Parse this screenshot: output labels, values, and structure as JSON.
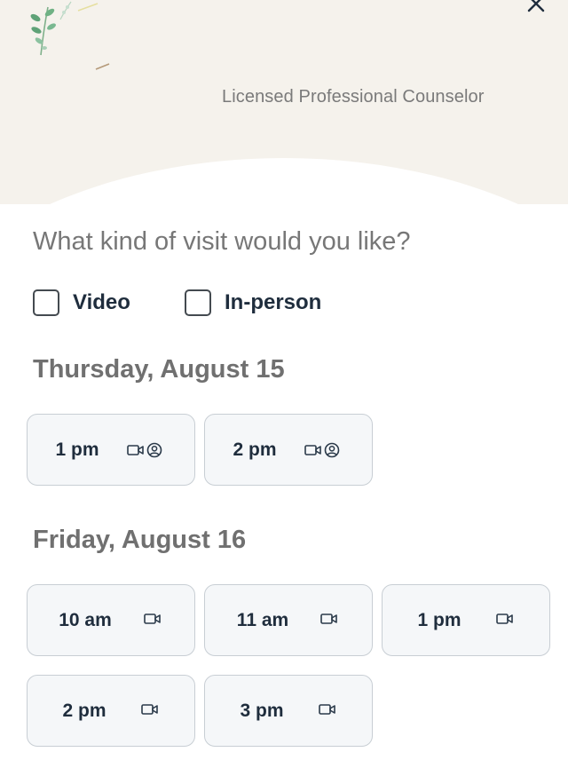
{
  "provider": {
    "credential": "Licensed Professional Counselor"
  },
  "visit_question": "What kind of visit would you like?",
  "visit_types": [
    {
      "label": "Video",
      "checked": false
    },
    {
      "label": "In-person",
      "checked": false
    }
  ],
  "days": [
    {
      "heading": "Thursday, August 15",
      "slots": [
        {
          "time": "1 pm",
          "icons": [
            "video-icon",
            "in-person-icon"
          ]
        },
        {
          "time": "2 pm",
          "icons": [
            "video-icon",
            "in-person-icon"
          ]
        }
      ]
    },
    {
      "heading": "Friday, August 16",
      "slots": [
        {
          "time": "10 am",
          "icons": [
            "video-icon"
          ]
        },
        {
          "time": "11 am",
          "icons": [
            "video-icon"
          ]
        },
        {
          "time": "1 pm",
          "icons": [
            "video-icon"
          ]
        },
        {
          "time": "2 pm",
          "icons": [
            "video-icon"
          ]
        },
        {
          "time": "3 pm",
          "icons": [
            "video-icon"
          ]
        }
      ]
    }
  ],
  "colors": {
    "header_bg": "#f5f2ec",
    "slot_bg": "#f5f7f9",
    "slot_border": "#c8ced4",
    "text_dark": "#1f2d3d",
    "text_muted": "#777777",
    "icon": "#2b3a4a"
  }
}
